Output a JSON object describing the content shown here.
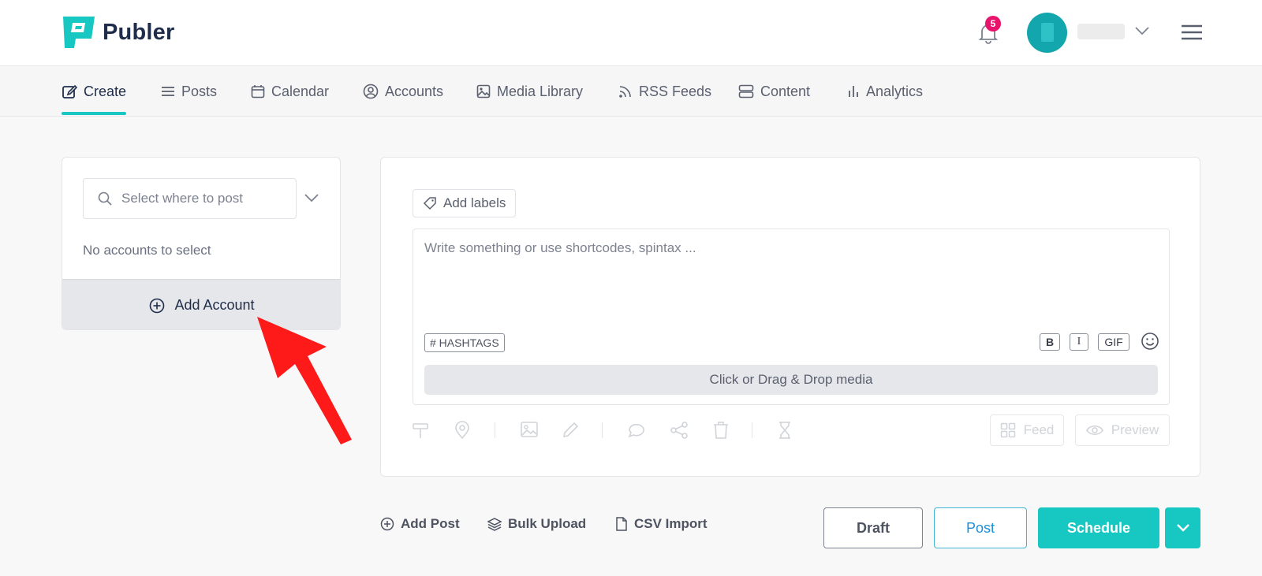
{
  "app": {
    "name": "Publer"
  },
  "header": {
    "notification_count": "5"
  },
  "nav": {
    "create": "Create",
    "posts": "Posts",
    "calendar": "Calendar",
    "accounts": "Accounts",
    "media_library": "Media Library",
    "rss_feeds": "RSS Feeds",
    "content": "Content",
    "analytics": "Analytics"
  },
  "account_selector": {
    "placeholder": "Select where to post",
    "empty_message": "No accounts to select",
    "add_account_label": "Add Account"
  },
  "composer": {
    "add_labels": "Add labels",
    "editor_placeholder": "Write something or use shortcodes, spintax ...",
    "hashtags_label": "# HASHTAGS",
    "bold_label": "B",
    "italic_label": "I",
    "gif_label": "GIF",
    "media_drop_label": "Click or Drag & Drop media",
    "feed_label": "Feed",
    "preview_label": "Preview"
  },
  "footer_actions": {
    "add_post": "Add Post",
    "bulk_upload": "Bulk Upload",
    "csv_import": "CSV Import",
    "draft": "Draft",
    "post": "Post",
    "schedule": "Schedule"
  },
  "colors": {
    "accent": "#17c7c2",
    "brand_dark": "#1f2d4a",
    "badge": "#e8146c",
    "annotation_arrow": "#ff1a1a"
  }
}
